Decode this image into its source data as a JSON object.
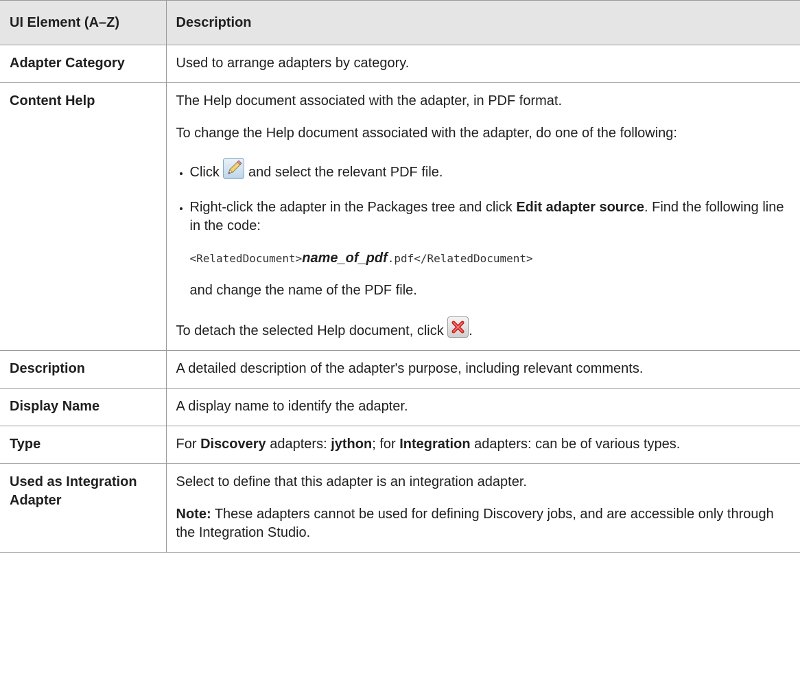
{
  "table": {
    "headers": {
      "element": "UI Element (A–Z)",
      "description": "Description"
    },
    "rows": {
      "adapter_category": {
        "name": "Adapter Category",
        "description": "Used to arrange adapters by category."
      },
      "content_help": {
        "name": "Content Help",
        "intro": "The Help document associated with the adapter, in PDF format.",
        "change_intro": "To change the Help document associated with the adapter, do one of the following:",
        "bullet1_pre": "Click",
        "bullet1_icon": "pencil-edit-icon",
        "bullet1_post": "and select the relevant PDF file.",
        "bullet2_pre": "Right-click the adapter in the Packages tree and click",
        "bullet2_bold": "Edit adapter source",
        "bullet2_post": ". Find the following line in the code:",
        "code_open": "<RelatedDocument>",
        "code_var": "name_of_pdf",
        "code_close": ".pdf</RelatedDocument>",
        "bullet2_after": "and change the name of the PDF file.",
        "detach_text": "To detach the selected Help document, click",
        "detach_icon": "red-x-delete-icon",
        "detach_end": "."
      },
      "description": {
        "name": "Description",
        "description": "A detailed description of the adapter's purpose, including relevant comments."
      },
      "display_name": {
        "name": "Display Name",
        "description": "A display name to identify the adapter."
      },
      "type": {
        "name": "Type",
        "t1": "For",
        "b1": "Discovery",
        "t2": "adapters:",
        "b2": "jython",
        "t3": "; for",
        "b3": "Integration",
        "t4": "adapters: can be of various types."
      },
      "used_as_integration": {
        "name": "Used as Integration Adapter",
        "description": "Select to define that this adapter is an integration adapter.",
        "note_label": "Note:",
        "note_text": "These adapters cannot be used for defining Discovery jobs, and are accessible only through the Integration Studio."
      }
    }
  }
}
